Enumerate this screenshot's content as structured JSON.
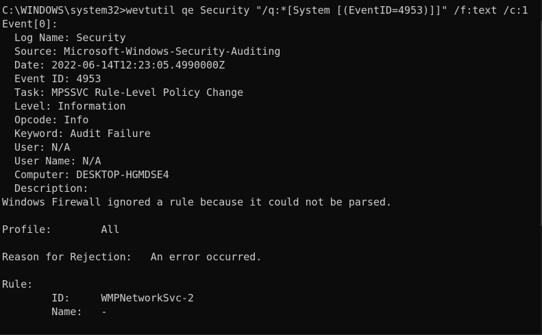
{
  "terminal": {
    "prompt": "C:\\WINDOWS\\system32>",
    "command": "wevtutil qe Security \"/q:*[System [(EventID=4953)]]\" /f:text /c:1",
    "output_lines": [
      "Event[0]:",
      "  Log Name: Security",
      "  Source: Microsoft-Windows-Security-Auditing",
      "  Date: 2022-06-14T12:23:05.4990000Z",
      "  Event ID: 4953",
      "  Task: MPSSVC Rule-Level Policy Change",
      "  Level: Information",
      "  Opcode: Info",
      "  Keyword: Audit Failure",
      "  User: N/A",
      "  User Name: N/A",
      "  Computer: DESKTOP-HGMDSE4",
      "  Description:",
      "Windows Firewall ignored a rule because it could not be parsed.",
      "",
      "Profile:        All",
      "",
      "Reason for Rejection:   An error occurred.",
      "",
      "Rule:",
      "        ID:     WMPNetworkSvc-2",
      "        Name:   -"
    ]
  },
  "colors": {
    "background": "#0c0c0c",
    "foreground": "#cccccc"
  }
}
